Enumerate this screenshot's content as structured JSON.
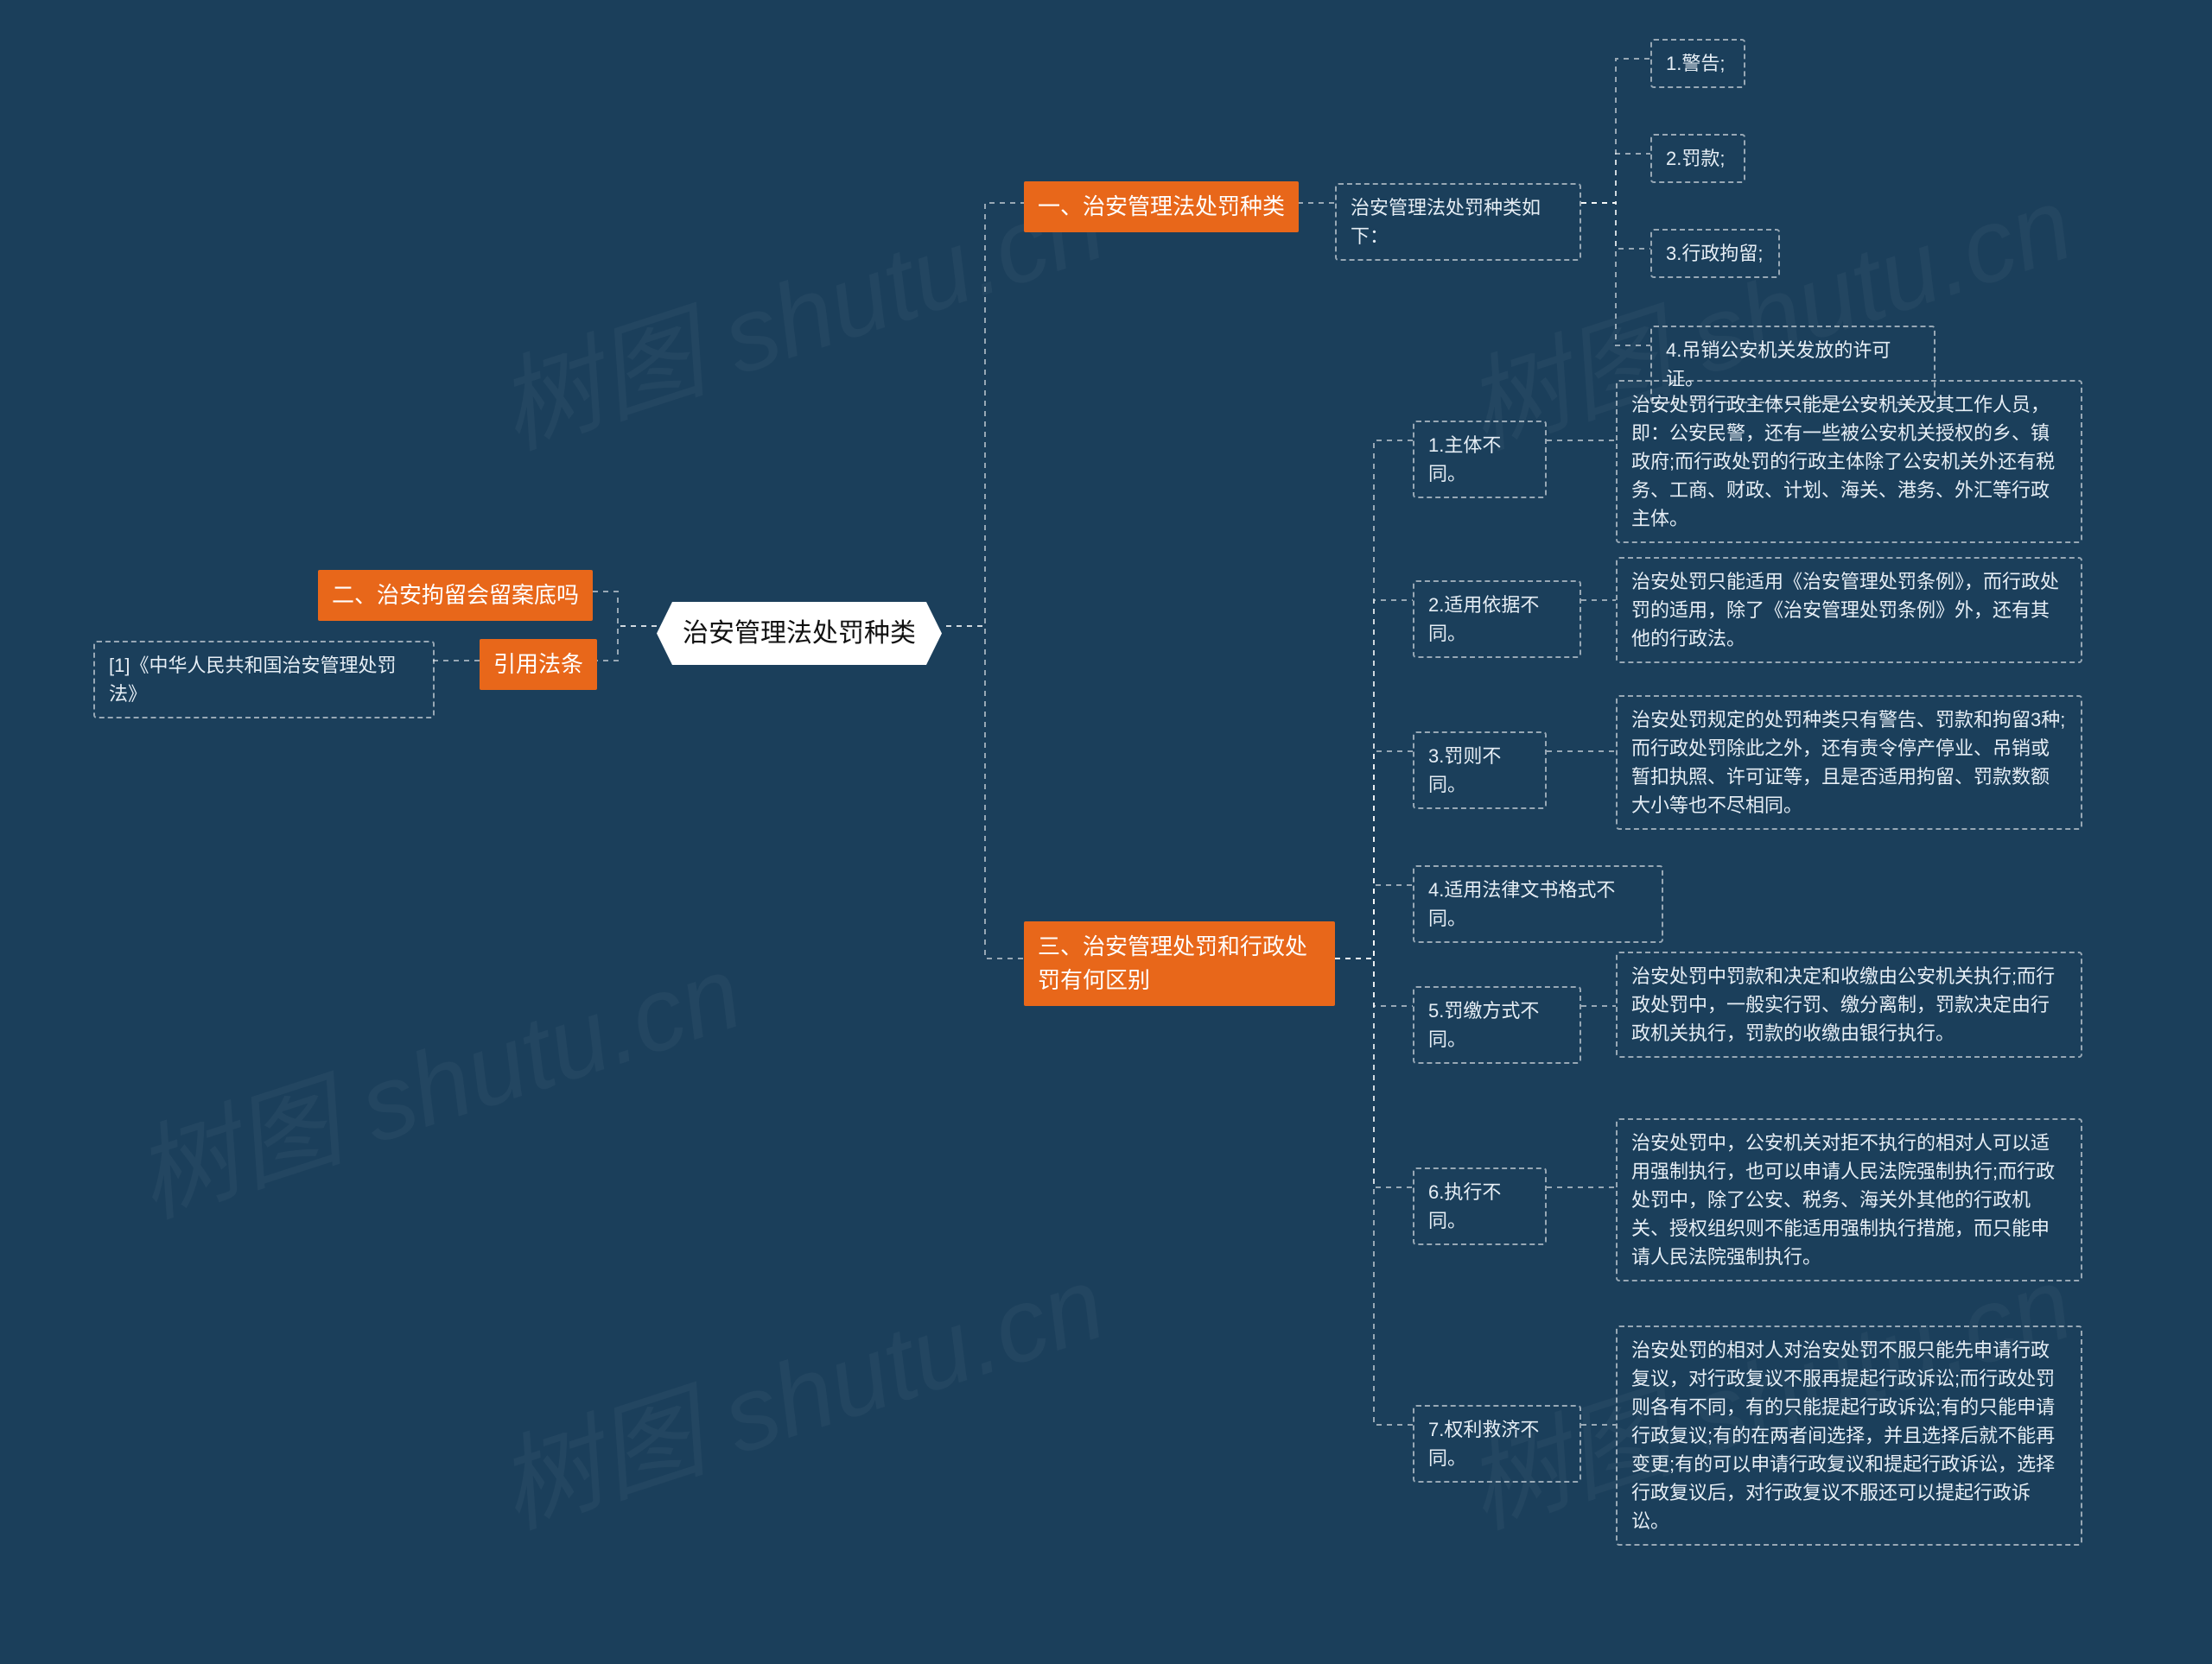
{
  "watermark": "树图 shutu.cn",
  "root": {
    "label": "治安管理法处罚种类"
  },
  "left": {
    "b2": {
      "label": "二、治安拘留会留案底吗"
    },
    "ref": {
      "label": "引用法条"
    },
    "ref_leaf": {
      "label": "[1]《中华人民共和国治安管理处罚法》"
    }
  },
  "b1": {
    "label": "一、治安管理法处罚种类",
    "intro": {
      "label": "治安管理法处罚种类如下："
    },
    "items": [
      {
        "label": "1.警告;"
      },
      {
        "label": "2.罚款;"
      },
      {
        "label": "3.行政拘留;"
      },
      {
        "label": "4.吊销公安机关发放的许可证。"
      }
    ]
  },
  "b3": {
    "label": "三、治安管理处罚和行政处罚有何区别",
    "items": [
      {
        "title": "1.主体不同。",
        "desc": "治安处罚行政主体只能是公安机关及其工作人员，即：公安民警，还有一些被公安机关授权的乡、镇政府;而行政处罚的行政主体除了公安机关外还有税务、工商、财政、计划、海关、港务、外汇等行政主体。"
      },
      {
        "title": "2.适用依据不同。",
        "desc": "治安处罚只能适用《治安管理处罚条例》，而行政处罚的适用，除了《治安管理处罚条例》外，还有其他的行政法。"
      },
      {
        "title": "3.罚则不同。",
        "desc": "治安处罚规定的处罚种类只有警告、罚款和拘留3种;而行政处罚除此之外，还有责令停产停业、吊销或暂扣执照、许可证等，且是否适用拘留、罚款数额大小等也不尽相同。"
      },
      {
        "title": "4.适用法律文书格式不同。"
      },
      {
        "title": "5.罚缴方式不同。",
        "desc": "治安处罚中罚款和决定和收缴由公安机关执行;而行政处罚中，一般实行罚、缴分离制，罚款决定由行政机关执行，罚款的收缴由银行执行。"
      },
      {
        "title": "6.执行不同。",
        "desc": "治安处罚中，公安机关对拒不执行的相对人可以适用强制执行，也可以申请人民法院强制执行;而行政处罚中，除了公安、税务、海关外其他的行政机关、授权组织则不能适用强制执行措施，而只能申请人民法院强制执行。"
      },
      {
        "title": "7.权利救济不同。",
        "desc": "治安处罚的相对人对治安处罚不服只能先申请行政复议，对行政复议不服再提起行政诉讼;而行政处罚则各有不同，有的只能提起行政诉讼;有的只能申请行政复议;有的在两者间选择，并且选择后就不能再变更;有的可以申请行政复议和提起行政诉讼，选择行政复议后，对行政复议不服还可以提起行政诉讼。"
      }
    ]
  }
}
